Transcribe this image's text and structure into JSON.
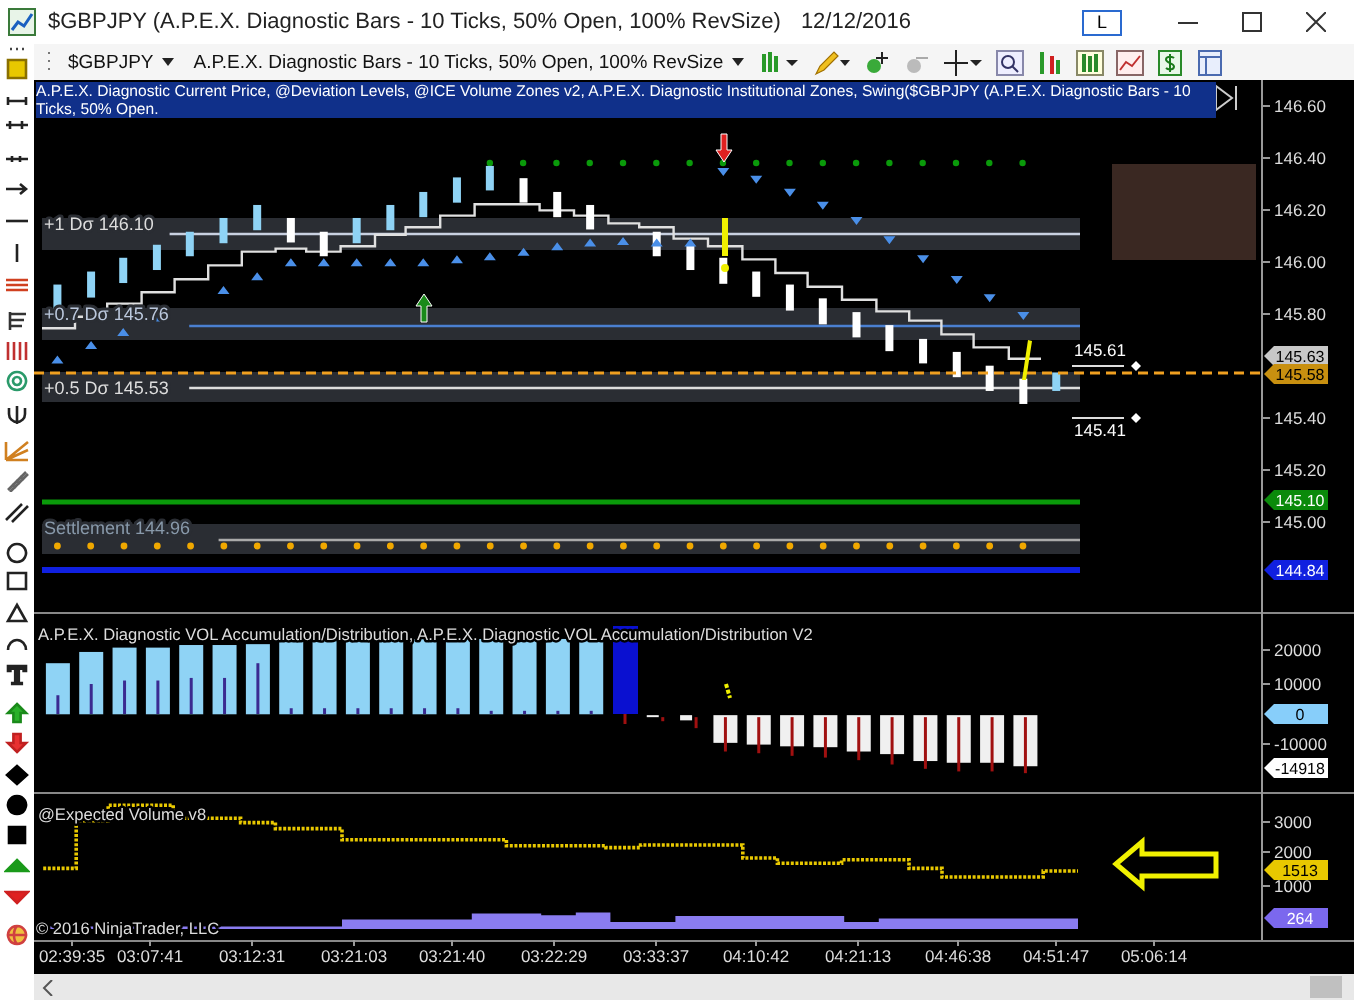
{
  "window": {
    "title": "$GBPJPY (A.P.E.X. Diagnostic Bars - 10 Ticks, 50% Open, 100% RevSize)",
    "date": "12/12/2016",
    "badge": "L"
  },
  "toolbar": {
    "instrument": "$GBPJPY",
    "bar_type": "A.P.E.X. Diagnostic Bars - 10 Ticks, 50% Open, 100% RevSize"
  },
  "price_panel": {
    "indicators_label": {
      "text": "A.P.E.X. Diagnostic Current Price, @Deviation Levels, @ICE Volume Zones v2, A.P.E.X. Diagnostic Institutional Zones, Swing($GBPJPY (A.P.E.X. Diagnostic Bars - 10 Ticks, 50% Open.",
      "selected": true
    },
    "levels": [
      {
        "label": "+1 Dσ 146.10"
      },
      {
        "label": "+0.7 Dσ 145.76"
      },
      {
        "label": "+0.5 Dσ 145.53"
      },
      {
        "label": "Settlement 144.96"
      }
    ],
    "swing_labels": [
      "145.61",
      "145.41"
    ],
    "axis_labels": [
      "146.60",
      "146.40",
      "146.20",
      "146.00",
      "145.80",
      "145.40",
      "145.20",
      "145.00"
    ],
    "price_tags": [
      {
        "text": "145.63",
        "color": "#c8c8c8"
      },
      {
        "text": "145.58",
        "color": "#c89010"
      },
      {
        "text": "145.10",
        "color": "#0a8a0a"
      },
      {
        "text": "144.84",
        "color": "#1020e0"
      }
    ]
  },
  "volume_panel": {
    "title": "A.P.E.X. Diagnostic VOL Accumulation/Distribution, A.P.E.X. Diagnostic VOL Accumulation/Distribution V2",
    "axis_labels": [
      "20000",
      "10000",
      "-10000"
    ],
    "tags": [
      {
        "text": "0",
        "color": "#87cefa"
      },
      {
        "text": "-14918",
        "color": "#ffffff"
      }
    ]
  },
  "expected_volume_panel": {
    "title": "@Expected Volume v8",
    "axis_labels": [
      "3000",
      "2000",
      "1000"
    ],
    "tags": [
      {
        "text": "1513",
        "color": "#e8c800"
      },
      {
        "text": "264",
        "color": "#7b68ee"
      }
    ],
    "copyright": "© 2016 NinjaTrader, LLC"
  },
  "time_axis": [
    "02:39:35",
    "03:07:41",
    "03:12:31",
    "03:21:03",
    "03:21:40",
    "03:22:29",
    "03:33:37",
    "04:10:42",
    "04:21:13",
    "04:46:38",
    "04:51:47",
    "05:06:14"
  ]
}
